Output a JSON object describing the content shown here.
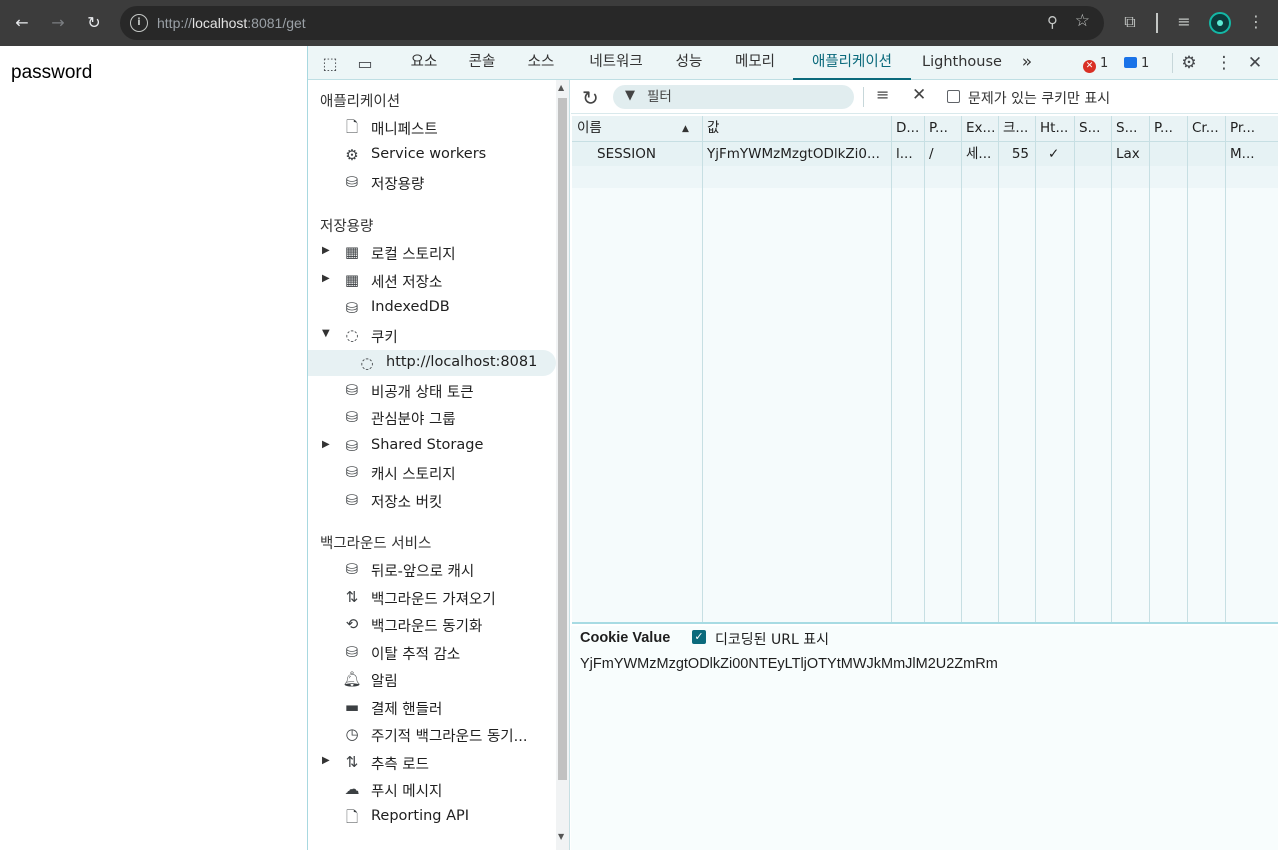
{
  "browser": {
    "url_scheme": "http://",
    "url_host": "localhost",
    "url_rest": ":8081/get",
    "back_icon": "arrow-left-icon",
    "forward_icon": "arrow-right-icon",
    "reload_icon": "reload-icon"
  },
  "page": {
    "text": "password"
  },
  "devtools": {
    "tabs": [
      {
        "label": "요소"
      },
      {
        "label": "콘솔"
      },
      {
        "label": "소스"
      },
      {
        "label": "네트워크"
      },
      {
        "label": "성능"
      },
      {
        "label": "메모리"
      },
      {
        "label": "애플리케이션"
      },
      {
        "label": "Lighthouse"
      }
    ],
    "more_tabs": "»",
    "error_count": "1",
    "message_count": "1",
    "accent_color": "#0b6a7c"
  },
  "sidebar": {
    "sections": [
      {
        "title": "애플리케이션"
      },
      {
        "title": "저장용량"
      },
      {
        "title": "백그라운드 서비스"
      }
    ],
    "app_items": [
      {
        "label": "매니페스트",
        "icon": "document-icon"
      },
      {
        "label": "Service workers",
        "icon": "gears-icon"
      },
      {
        "label": "저장용량",
        "icon": "database-icon"
      }
    ],
    "storage_items": [
      {
        "label": "로컬 스토리지",
        "icon": "table-icon"
      },
      {
        "label": "세션 저장소",
        "icon": "table-icon"
      },
      {
        "label": "IndexedDB",
        "icon": "database-icon"
      },
      {
        "label": "쿠키",
        "icon": "cookie-icon"
      },
      {
        "label": "http://localhost:8081",
        "icon": "cookie-icon"
      },
      {
        "label": "비공개 상태 토큰",
        "icon": "database-icon"
      },
      {
        "label": "관심분야 그룹",
        "icon": "database-icon"
      },
      {
        "label": "Shared Storage",
        "icon": "database-icon"
      },
      {
        "label": "캐시 스토리지",
        "icon": "database-icon"
      },
      {
        "label": "저장소 버킷",
        "icon": "database-icon"
      }
    ],
    "bg_items": [
      {
        "label": "뒤로-앞으로 캐시",
        "icon": "database-icon"
      },
      {
        "label": "백그라운드 가져오기",
        "icon": "up-down-arrows-icon"
      },
      {
        "label": "백그라운드 동기화",
        "icon": "sync-icon"
      },
      {
        "label": "이탈 추적 감소",
        "icon": "database-icon"
      },
      {
        "label": "알림",
        "icon": "bell-icon"
      },
      {
        "label": "결제 핸들러",
        "icon": "credit-card-icon"
      },
      {
        "label": "주기적 백그라운드 동기...",
        "icon": "clock-icon"
      },
      {
        "label": "추측 로드",
        "icon": "up-down-arrows-icon"
      },
      {
        "label": "푸시 메시지",
        "icon": "cloud-icon"
      },
      {
        "label": "Reporting API",
        "icon": "document-icon"
      }
    ]
  },
  "cookies": {
    "filter_placeholder": "필터",
    "issues_only_label": "문제가 있는 쿠키만 표시",
    "columns": [
      "이름",
      "값",
      "D...",
      "P...",
      "Ex...",
      "크...",
      "Ht...",
      "S...",
      "S...",
      "P...",
      "Cr...",
      "Pr..."
    ],
    "rows": [
      [
        "SESSION",
        "YjFmYWMzMzgtODlkZi0...",
        "l...",
        "/",
        "세...",
        "55",
        "✓",
        "",
        "Lax",
        "",
        "",
        "M..."
      ]
    ],
    "value_title": "Cookie Value",
    "decoded_label": "디코딩된 URL 표시",
    "decoded_checked": true,
    "value": "YjFmYWMzMzgtODlkZi00NTEyLTljOTYtMWJkMmJlM2U2ZmRm"
  }
}
